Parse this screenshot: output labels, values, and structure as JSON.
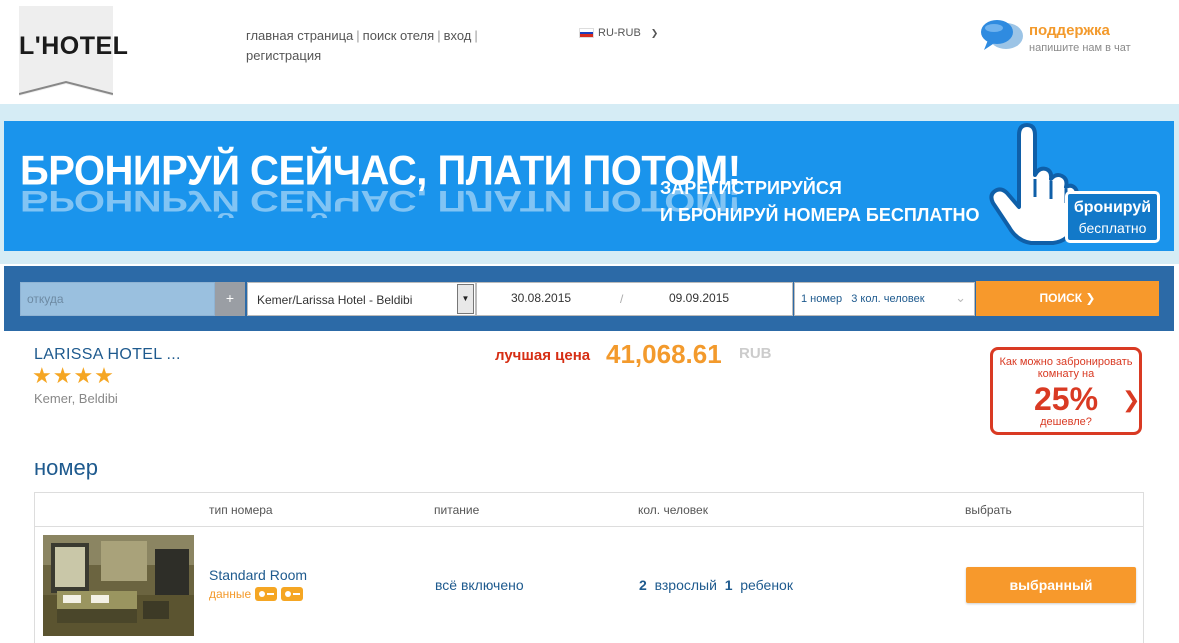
{
  "header": {
    "logo_text": "L'HOTEL",
    "nav": [
      "главная страница",
      "поиск отеля",
      "вход",
      "регистрация"
    ],
    "currency_selector": "RU-RUB",
    "support_title": "поддержка",
    "support_subtitle": "напишите нам в чат"
  },
  "banner": {
    "headline": "БРОНИРУЙ СЕЙЧАС, ПЛАТИ ПОТОМ!",
    "sub_line1": "ЗАРЕГИСТРИРУЙСЯ",
    "sub_line2": "И БРОНИРУЙ НОМЕРА БЕСПЛАТНО",
    "button_line1": "бронируй",
    "button_line2": "бесплатно"
  },
  "search": {
    "from_placeholder": "откуда",
    "add_label": "+",
    "hotel_value": "Kemer/Larissa Hotel - Beldibi",
    "date_from": "30.08.2015",
    "date_sep": "/",
    "date_to": "09.09.2015",
    "rooms": "1 номер",
    "guests": "3 кол. человек",
    "button": "ПОИСК"
  },
  "hotel": {
    "name": "LARISSA HOTEL ...",
    "stars": "★★★★",
    "location": "Kemer, Beldibi",
    "best_label": "лучшая цена",
    "best_price": "41,068.61",
    "best_currency": "RUB"
  },
  "promo": {
    "question": "Как можно забронировать комнату на",
    "percent": "25%",
    "cheaper": "дешевле?"
  },
  "rooms_section": {
    "title": "номер",
    "headers": [
      "тип номера",
      "питание",
      "кол. человек",
      "выбрать"
    ],
    "rows": [
      {
        "name": "Standard Room",
        "data_label": "данные",
        "meal": "всё включено",
        "adults_count": "2",
        "adults_label": "взрослый",
        "children_count": "1",
        "children_label": "ребенок",
        "button": "выбранный"
      }
    ]
  },
  "colors": {
    "accent_orange": "#f7992c",
    "brand_blue": "#1e5a8e",
    "banner_blue": "#1a94ec",
    "search_bar_blue": "#2c6aa7",
    "promo_red": "#d93a23"
  }
}
